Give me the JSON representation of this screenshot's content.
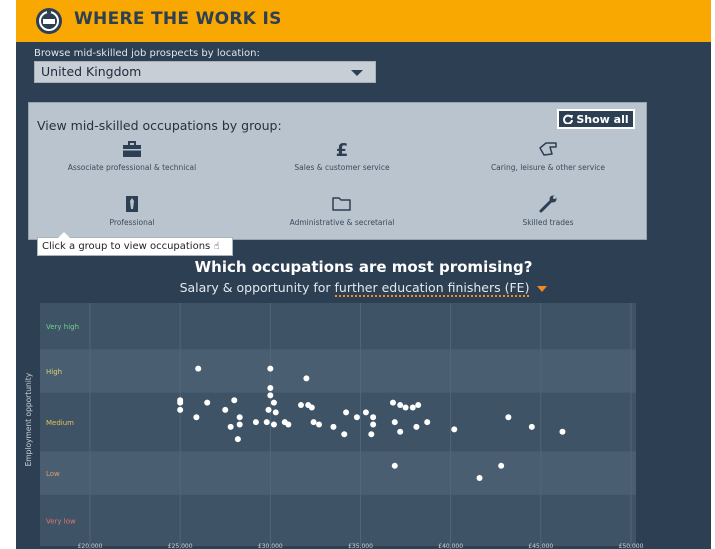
{
  "app": {
    "title": "WHERE THE WORK IS",
    "logo_icon": "compass-logo-icon",
    "brand_color": "#f8a800",
    "bg_color": "#2d3f52"
  },
  "location": {
    "label": "Browse mid-skilled job prospects by location:",
    "selected": "United Kingdom"
  },
  "groups_panel": {
    "title": "View mid-skilled occupations by group:",
    "show_all_label": "Show all",
    "show_all_icon": "refresh-icon",
    "groups": [
      {
        "label": "Associate professional & technical",
        "icon": "briefcase-icon"
      },
      {
        "label": "Sales & customer service",
        "icon": "pound-icon"
      },
      {
        "label": "Caring, leisure & other service",
        "icon": "hand-icon"
      },
      {
        "label": "Professional",
        "icon": "tie-icon"
      },
      {
        "label": "Administrative & secretarial",
        "icon": "folder-icon"
      },
      {
        "label": "Skilled trades",
        "icon": "wrench-icon"
      }
    ],
    "tooltip": "Click a group to view occupations"
  },
  "heading": "Which occupations are most promising?",
  "subheading": {
    "prefix": "Salary & opportunity for",
    "selected": "further education finishers (FE)",
    "accent_color": "#f08a24"
  },
  "chart_data": {
    "type": "scatter",
    "ylabel": "Employment opportunity",
    "bands": [
      {
        "label": "Very high",
        "color": "#6fd08c"
      },
      {
        "label": "High",
        "color": "#d9d36a"
      },
      {
        "label": "Medium",
        "color": "#e6c15a"
      },
      {
        "label": "Low",
        "color": "#e59a6a"
      },
      {
        "label": "Very low",
        "color": "#e07575"
      }
    ],
    "x_ticks": [
      "£20,000",
      "£25,000",
      "£30,000",
      "£35,000",
      "£40,000",
      "£45,000",
      "£50,000"
    ],
    "xlim": [
      20000,
      50000
    ],
    "points": [
      [
        26000,
        0.73
      ],
      [
        30000,
        0.73
      ],
      [
        32000,
        0.69
      ],
      [
        30000,
        0.65
      ],
      [
        30000,
        0.62
      ],
      [
        25000,
        0.6
      ],
      [
        25000,
        0.59
      ],
      [
        26500,
        0.59
      ],
      [
        28000,
        0.6
      ],
      [
        30200,
        0.59
      ],
      [
        31700,
        0.58
      ],
      [
        32100,
        0.58
      ],
      [
        32300,
        0.57
      ],
      [
        36800,
        0.59
      ],
      [
        37200,
        0.58
      ],
      [
        37500,
        0.57
      ],
      [
        37900,
        0.57
      ],
      [
        38200,
        0.58
      ],
      [
        29900,
        0.56
      ],
      [
        25000,
        0.56
      ],
      [
        27500,
        0.56
      ],
      [
        30300,
        0.55
      ],
      [
        34200,
        0.55
      ],
      [
        35300,
        0.55
      ],
      [
        25900,
        0.53
      ],
      [
        28300,
        0.53
      ],
      [
        34800,
        0.53
      ],
      [
        35700,
        0.53
      ],
      [
        43200,
        0.53
      ],
      [
        32400,
        0.51
      ],
      [
        29200,
        0.51
      ],
      [
        29800,
        0.51
      ],
      [
        30800,
        0.51
      ],
      [
        36900,
        0.51
      ],
      [
        38700,
        0.51
      ],
      [
        28300,
        0.5
      ],
      [
        27800,
        0.49
      ],
      [
        30200,
        0.5
      ],
      [
        31000,
        0.5
      ],
      [
        32700,
        0.5
      ],
      [
        33500,
        0.49
      ],
      [
        35700,
        0.5
      ],
      [
        38100,
        0.49
      ],
      [
        40200,
        0.48
      ],
      [
        44500,
        0.49
      ],
      [
        46200,
        0.47
      ],
      [
        37200,
        0.47
      ],
      [
        34100,
        0.46
      ],
      [
        35600,
        0.46
      ],
      [
        28200,
        0.44
      ],
      [
        36900,
        0.33
      ],
      [
        42800,
        0.33
      ],
      [
        41600,
        0.28
      ]
    ]
  }
}
